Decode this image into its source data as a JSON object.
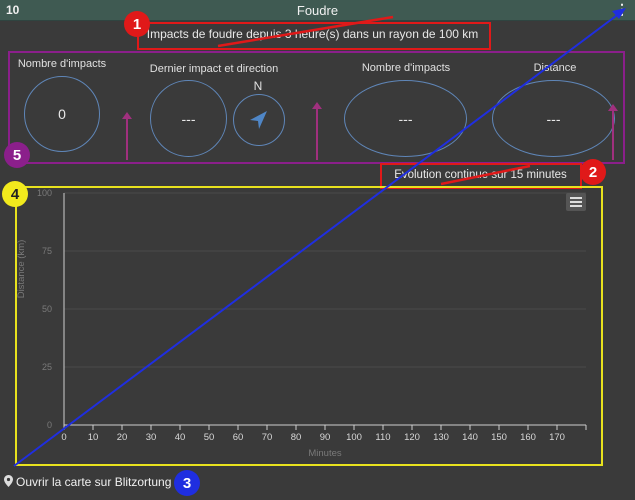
{
  "header": {
    "id": "10",
    "title": "Foudre",
    "menu_icon": "⋮"
  },
  "subtitle": "Impacts de foudre depuis 3 heure(s) dans un rayon de 100 km",
  "stats": {
    "count_label": "Nombre d'impacts",
    "count_value": "0",
    "last_label": "Dernier impact et direction",
    "last_value": "---",
    "compass_label": "N",
    "count2_label": "Nombre d'impacts",
    "count2_value": "---",
    "distance_label": "Distance",
    "distance_value": "---"
  },
  "evolution_label": "Evolution continue sur 15 minutes",
  "chart_data": {
    "type": "scatter",
    "ylabel": "Distance (km)",
    "xlabel": "Minutes",
    "xlim": [
      0,
      180
    ],
    "ylim": [
      0,
      100
    ],
    "xticks": [
      0,
      10,
      20,
      30,
      40,
      50,
      60,
      70,
      80,
      90,
      100,
      110,
      120,
      130,
      140,
      150,
      160,
      170
    ],
    "yticks": [
      0,
      25,
      50,
      75,
      100
    ],
    "series": []
  },
  "link_label": "Ouvrir la carte sur Blitzortung",
  "annotations": [
    "1",
    "2",
    "3",
    "4",
    "5"
  ],
  "colors": {
    "panel_bg": "#3a3a3a",
    "header_bg": "#3f5a52",
    "gauge": "#5f86b8",
    "annot_red": "#e01919",
    "annot_purple": "#8b1f8b",
    "annot_yellow": "#e8e21e",
    "annot_blue": "#1f2ee0"
  }
}
